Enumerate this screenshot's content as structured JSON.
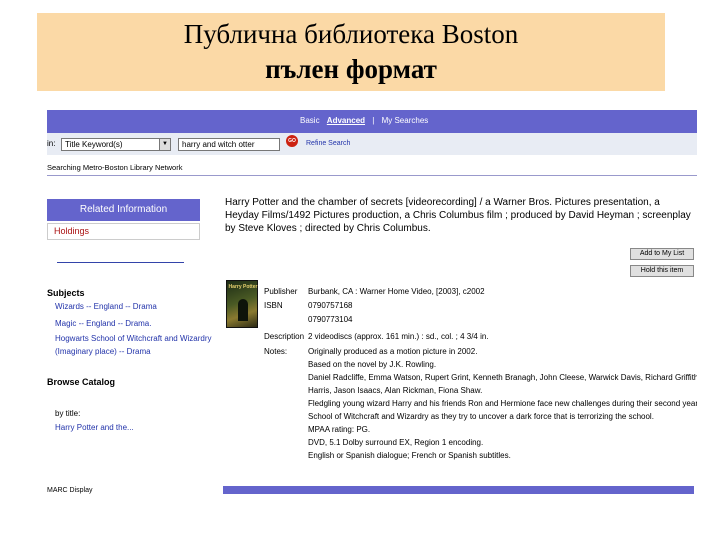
{
  "slide": {
    "title_line1": "Публична библиотека Boston",
    "title_line2": "пълен формат"
  },
  "colors": {
    "banner": "#fbd9a6",
    "nav_bar": "#6464cc",
    "link": "#2233aa",
    "holdings": "#aa1111"
  },
  "catalog": {
    "nav": {
      "basic": "Basic",
      "advanced": "Advanced",
      "separator": "|",
      "my_searches": "My Searches"
    },
    "search": {
      "label": "in:",
      "field_select": "Title Keyword(s)",
      "query": "harry and witch otter",
      "go_label": "GO",
      "refine_link": "Refine Search"
    },
    "searching_line": "Searching Metro-Boston Library Network",
    "left": {
      "related_header": "Related Information",
      "holdings": "Holdings",
      "subjects_heading": "Subjects",
      "subjects": [
        "Wizards -- England -- Drama",
        "Magic -- England -- Drama.",
        "Hogwarts School of Witchcraft and Wizardry",
        "(Imaginary place) -- Drama"
      ],
      "browse_heading": "Browse Catalog",
      "by_title_label": "by title:",
      "browse_link": "Harry Potter and the...",
      "marc_link": "MARC Display"
    },
    "record": {
      "title": "Harry Potter and the chamber of secrets [videorecording] / a Warner Bros. Pictures presentation, a Heyday Films/1492 Pictures production, a Chris Columbus film ; produced by David Heyman ; screenplay by Steve Kloves ; directed by Chris Columbus.",
      "buttons": [
        "Add to My List",
        "Hold this item"
      ],
      "cover_title": "Harry Potter",
      "fields": [
        {
          "label": "Publisher",
          "value": "Burbank, CA : Warner Home Video, [2003], c2002"
        },
        {
          "label": "ISBN",
          "value": "0790757168"
        },
        {
          "label": "",
          "value": "0790773104"
        },
        {
          "label": "Description",
          "value": "2 videodiscs (approx. 161 min.) : sd., col. ; 4 3/4 in."
        },
        {
          "label": "Notes:",
          "value": "Originally produced as a motion picture in 2002."
        },
        {
          "label": "",
          "value": "Based on the novel by J.K. Rowling."
        },
        {
          "label": "",
          "value": "Daniel Radcliffe, Emma Watson, Rupert Grint, Kenneth Branagh, John Cleese, Warwick Davis, Richard Griffiths, Fiona"
        },
        {
          "label": "",
          "value": "Harris, Jason Isaacs, Alan Rickman, Fiona Shaw."
        },
        {
          "label": "",
          "value": "Fledgling young wizard Harry and his friends Ron and Hermione face new challenges during their second year at Hogwarts"
        },
        {
          "label": "",
          "value": "School of Witchcraft and Wizardry as they try to uncover a dark force that is terrorizing the school."
        },
        {
          "label": "",
          "value": "MPAA rating: PG."
        },
        {
          "label": "",
          "value": "DVD, 5.1 Dolby surround EX, Region 1 encoding."
        },
        {
          "label": "",
          "value": "English or Spanish dialogue; French or Spanish subtitles."
        }
      ]
    }
  }
}
